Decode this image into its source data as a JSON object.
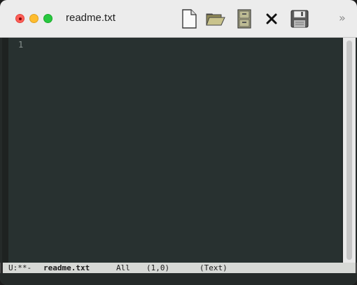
{
  "window": {
    "title": "readme.txt"
  },
  "toolbar": {
    "tools": [
      {
        "name": "new-file",
        "icon": "document-icon"
      },
      {
        "name": "open-folder",
        "icon": "folder-icon"
      },
      {
        "name": "file-cabinet",
        "icon": "cabinet-icon"
      },
      {
        "name": "close-buffer",
        "icon": "x-icon"
      },
      {
        "name": "save",
        "icon": "floppy-icon"
      }
    ],
    "overflow_glyph": "»"
  },
  "editor": {
    "line_numbers": [
      "1"
    ],
    "colors": {
      "background": "#283130",
      "line_number": "#8a9391"
    }
  },
  "modeline": {
    "status": "U:**-",
    "buffer_name": "readme.txt",
    "position": "All",
    "line_col": "(1,0)",
    "major_mode": "(Text)"
  }
}
